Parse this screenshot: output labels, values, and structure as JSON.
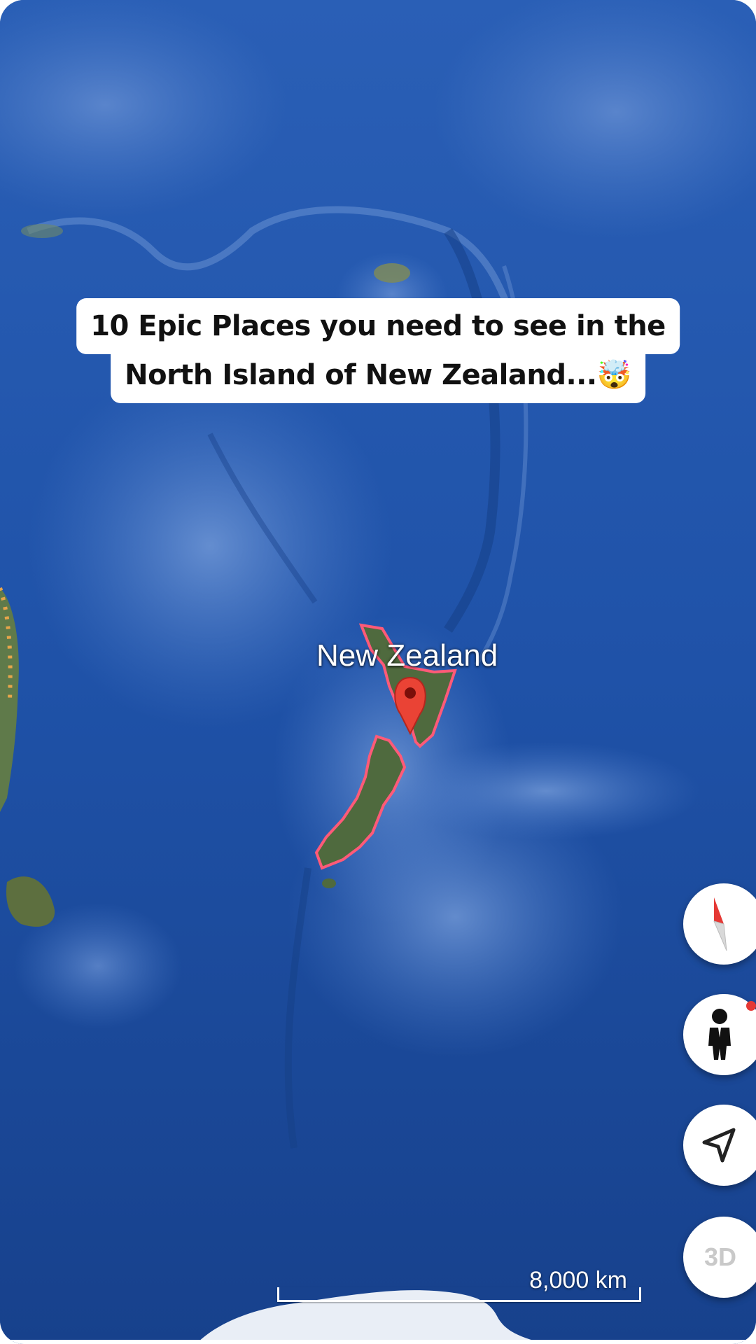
{
  "caption": {
    "line1": "10 Epic Places you need to see in the",
    "line2": "North Island of New Zealand...🤯"
  },
  "map": {
    "place_label": "New Zealand",
    "marker_color": "#ea4335",
    "outline_color": "#ff5a78",
    "ocean_color": "#1f4f9e"
  },
  "controls": {
    "compass_icon": "compass-icon",
    "street_view_icon": "pegman-icon",
    "my_location_icon": "navigation-arrow-icon",
    "view_3d_label": "3D"
  },
  "scale": {
    "label": "8,000 km"
  }
}
